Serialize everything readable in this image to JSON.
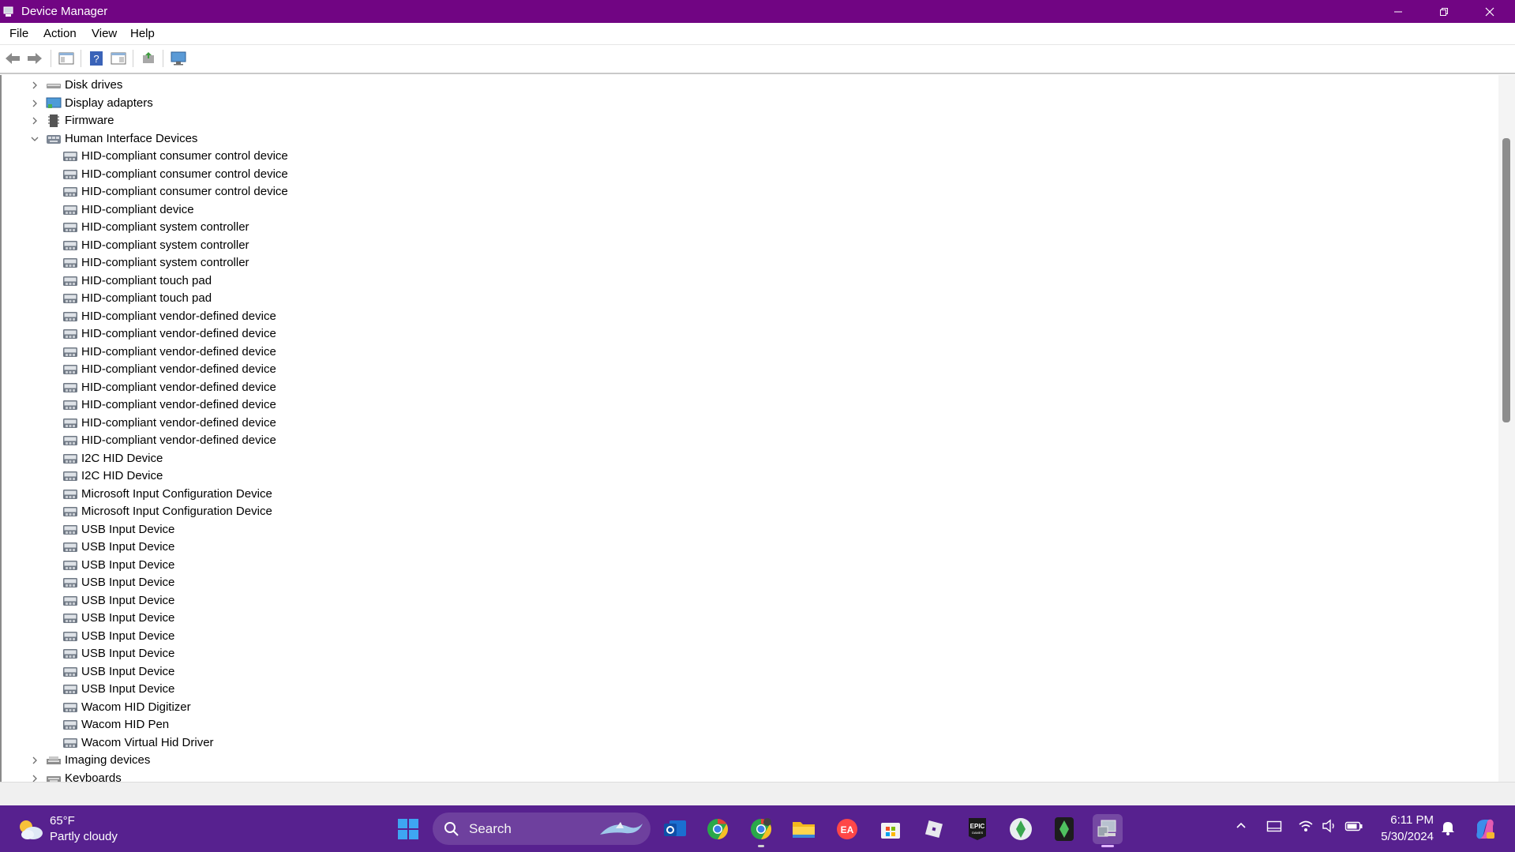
{
  "window": {
    "title": "Device Manager",
    "titlebar_color": "#710583"
  },
  "menu": {
    "items": [
      "File",
      "Action",
      "View",
      "Help"
    ]
  },
  "tree": {
    "collapsed_top": [
      {
        "label": "Disk drives",
        "icon": "disk-drive-icon"
      },
      {
        "label": "Display adapters",
        "icon": "display-adapter-icon"
      },
      {
        "label": "Firmware",
        "icon": "firmware-icon"
      }
    ],
    "expanded_category": {
      "label": "Human Interface Devices",
      "icon": "hid-category-icon"
    },
    "hid_devices": [
      "HID-compliant consumer control device",
      "HID-compliant consumer control device",
      "HID-compliant consumer control device",
      "HID-compliant device",
      "HID-compliant system controller",
      "HID-compliant system controller",
      "HID-compliant system controller",
      "HID-compliant touch pad",
      "HID-compliant touch pad",
      "HID-compliant vendor-defined device",
      "HID-compliant vendor-defined device",
      "HID-compliant vendor-defined device",
      "HID-compliant vendor-defined device",
      "HID-compliant vendor-defined device",
      "HID-compliant vendor-defined device",
      "HID-compliant vendor-defined device",
      "HID-compliant vendor-defined device",
      "I2C HID Device",
      "I2C HID Device",
      "Microsoft Input Configuration Device",
      "Microsoft Input Configuration Device",
      "USB Input Device",
      "USB Input Device",
      "USB Input Device",
      "USB Input Device",
      "USB Input Device",
      "USB Input Device",
      "USB Input Device",
      "USB Input Device",
      "USB Input Device",
      "USB Input Device",
      "Wacom HID Digitizer",
      "Wacom HID Pen",
      "Wacom Virtual Hid Driver"
    ],
    "collapsed_bottom": [
      {
        "label": "Imaging devices",
        "icon": "imaging-device-icon"
      },
      {
        "label": "Keyboards",
        "icon": "keyboard-icon"
      }
    ]
  },
  "taskbar": {
    "color": "#57218f",
    "weather": {
      "temp": "65°F",
      "condition": "Partly cloudy"
    },
    "search_label": "Search",
    "clock": {
      "time": "6:11 PM",
      "date": "5/30/2024"
    }
  }
}
